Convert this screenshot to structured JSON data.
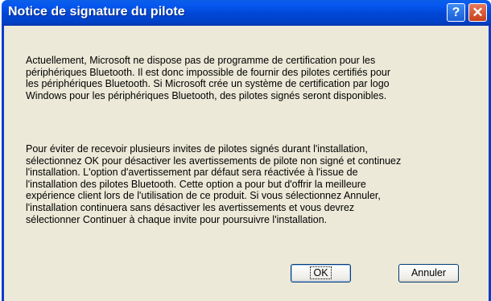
{
  "dialog": {
    "title": "Notice de signature du pilote",
    "help_glyph": "?",
    "close_glyph": "✕",
    "paragraph1": [
      "Actuellement, Microsoft ne dispose pas de programme de certification pour les",
      "périphériques Bluetooth. Il est donc impossible de fournir des pilotes certifiés pour",
      "les périphériques Bluetooth.  Si Microsoft crée un système de certification par logo",
      "Windows pour les périphériques Bluetooth, des pilotes signés seront disponibles."
    ],
    "paragraph2": [
      "Pour éviter de recevoir plusieurs invites de pilotes signés durant l'installation,",
      "sélectionnez OK pour désactiver les avertissements de pilote non signé et continuez",
      "l'installation. L'option d'avertissement par défaut sera réactivée à l'issue de",
      "l'installation des pilotes Bluetooth. Cette option a pour but d'offrir la meilleure",
      "expérience client lors de l'utilisation de ce produit. Si vous sélectionnez Annuler,",
      "l'installation continuera sans désactiver les avertissements et vous devrez",
      "sélectionner Continuer à chaque invite pour poursuivre l'installation."
    ],
    "ok_label": "OK",
    "cancel_label": "Annuler"
  },
  "colors": {
    "titlebar": "#0046d5",
    "dialog_background": "#ece9d8",
    "close_button": "#c7401a"
  }
}
